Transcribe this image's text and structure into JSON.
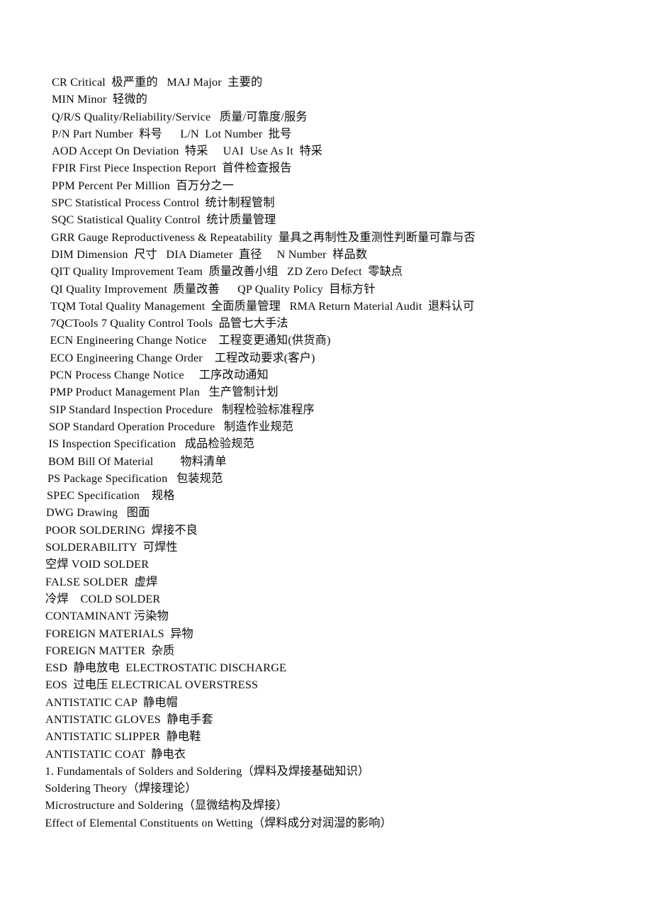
{
  "document": {
    "page_background": "#ffffff",
    "text_color": "#0a0a0a",
    "lines": [
      {
        "text": "CR Critical  极严重的   MAJ Major  主要的",
        "indent": "i0"
      },
      {
        "text": "MIN Minor  轻微的",
        "indent": "i0"
      },
      {
        "text": "Q/R/S Quality/Reliability/Service   质量/可靠度/服务",
        "indent": "i0"
      },
      {
        "text": "P/N Part Number  料号      L/N  Lot Number  批号",
        "indent": "i0"
      },
      {
        "text": "AOD Accept On Deviation  特采     UAI  Use As It  特采",
        "indent": "i0"
      },
      {
        "text": "FPIR First Piece Inspection Report  首件检查报告",
        "indent": "i0"
      },
      {
        "text": "PPM Percent Per Million  百万分之一",
        "indent": "i0"
      },
      {
        "text": "SPC Statistical Process Control  统计制程管制",
        "indent": "i1"
      },
      {
        "text": "SQC Statistical Quality Control  统计质量管理",
        "indent": "i1"
      },
      {
        "text": "GRR Gauge Reproductiveness & Repeatability  量具之再制性及重测性判断量可靠与否",
        "indent": "i2"
      },
      {
        "text": "DIM Dimension  尺寸   DIA Diameter  直径     N Number  样品数",
        "indent": "i2"
      },
      {
        "text": "QIT Quality Improvement Team  质量改善小组   ZD Zero Defect  零缺点",
        "indent": "i3"
      },
      {
        "text": "QI Quality Improvement  质量改善      QP Quality Policy  目标方针",
        "indent": "i3"
      },
      {
        "text": "TQM Total Quality Management  全面质量管理   RMA Return Material Audit  退料认可",
        "indent": "i4"
      },
      {
        "text": "7QCTools 7 Quality Control Tools  品管七大手法",
        "indent": "i4"
      },
      {
        "text": "ECN Engineering Change Notice    工程变更通知(供货商)",
        "indent": "i5"
      },
      {
        "text": "ECO Engineering Change Order    工程改动要求(客户)",
        "indent": "i5"
      },
      {
        "text": "PCN Process Change Notice     工序改动通知",
        "indent": "i6"
      },
      {
        "text": "PMP Product Management Plan   生产管制计划",
        "indent": "i6"
      },
      {
        "text": "SIP Standard Inspection Procedure   制程检验标准程序",
        "indent": "i7"
      },
      {
        "text": "SOP Standard Operation Procedure   制造作业规范",
        "indent": "i8"
      },
      {
        "text": "IS Inspection Specification   成品检验规范",
        "indent": "i9"
      },
      {
        "text": "BOM Bill Of Material         物料清单",
        "indent": "i10"
      },
      {
        "text": "PS Package Specification   包装规范",
        "indent": "i11"
      },
      {
        "text": "SPEC Specification    规格",
        "indent": "i12"
      },
      {
        "text": "DWG Drawing   图面",
        "indent": "i13"
      },
      {
        "text": "POOR SOLDERING  焊接不良",
        "indent": "i15"
      },
      {
        "text": "SOLDERABILITY  可焊性",
        "indent": "i15"
      },
      {
        "text": "空焊 VOID SOLDER",
        "indent": "i15"
      },
      {
        "text": "FALSE SOLDER  虚焊",
        "indent": "i15"
      },
      {
        "text": "冷焊    COLD SOLDER",
        "indent": "i15"
      },
      {
        "text": "CONTAMINANT 污染物",
        "indent": "i15"
      },
      {
        "text": "FOREIGN MATERIALS  异物",
        "indent": "i15"
      },
      {
        "text": "FOREIGN MATTER  杂质",
        "indent": "i15"
      },
      {
        "text": "ESD  静电放电  ELECTROSTATIC DISCHARGE",
        "indent": "i15"
      },
      {
        "text": "EOS  过电压 ELECTRICAL OVERSTRESS",
        "indent": "i15"
      },
      {
        "text": "ANTISTATIC CAP  静电帽",
        "indent": "i15"
      },
      {
        "text": "ANTISTATIC GLOVES  静电手套",
        "indent": "i15"
      },
      {
        "text": "ANTISTATIC SLIPPER  静电鞋",
        "indent": "i15"
      },
      {
        "text": "ANTISTATIC COAT  静电衣",
        "indent": "i15"
      },
      {
        "text": "1. Fundamentals of Solders and Soldering（焊料及焊接基础知识）",
        "indent": "i16"
      },
      {
        "text": "Soldering Theory（焊接理论）",
        "indent": "i16"
      },
      {
        "text": "Microstructure and Soldering（显微结构及焊接）",
        "indent": "i16"
      },
      {
        "text": "Effect of Elemental Constituents on Wetting（焊料成分对润湿的影响）",
        "indent": "i16"
      }
    ]
  }
}
